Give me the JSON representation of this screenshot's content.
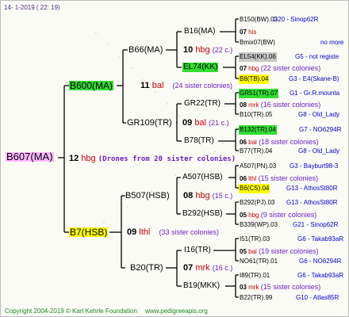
{
  "header": {
    "date": "14- 1-2019 ( 22: 19)"
  },
  "footer": {
    "copyright": "Copyright 2004-2019 © Karl Kehrle Foundation",
    "site": "www.pedigreeapis.org"
  },
  "colors": {
    "pink": "#ffb8ff",
    "yellow": "#ffff00",
    "green": "#33dd33",
    "gray": "#c8c8c8",
    "line": "#000000"
  },
  "gen0": {
    "name": "B607(MA)"
  },
  "gen1": {
    "top": {
      "name": "B600(MA)",
      "num": "11",
      "kw": "bal",
      "note": "(24 sister colonies)"
    },
    "drones": {
      "num": "12",
      "kw": "hbg",
      "note": "(Drones from 20 sister colonies)"
    },
    "bottom": {
      "name": "B7(HSB)",
      "num": "09",
      "kw": "lthl",
      "note": "(33 sister colonies)"
    }
  },
  "gen2": {
    "a": {
      "name": "B66(MA)",
      "num": "10",
      "kw": "hbg",
      "note": "(22 c.)"
    },
    "b": {
      "name": "GR109(TR)",
      "num": "09",
      "kw": "bal",
      "note": "(21 c.)"
    },
    "c": {
      "name": "B507(HSB)",
      "num": "08",
      "kw": "hbg",
      "note": "(15 c.)"
    },
    "d": {
      "name": "B20(TR)",
      "num": "07",
      "kw": "mrk",
      "note": "(16 c.)"
    }
  },
  "gen3": {
    "a": {
      "name": "B16(MA)",
      "num": "07",
      "kw": "his"
    },
    "b": {
      "name": "EL74(KK)",
      "num": "07",
      "kw": "hbg",
      "note": "(22 sister colonies)"
    },
    "c": {
      "name": "GR22(TR)",
      "num": "08",
      "kw": "mrk",
      "note": "(16 sister colonies)"
    },
    "d": {
      "name": "B78(TR)",
      "num": "06",
      "kw": "bal",
      "note": "(18 sister colonies)"
    },
    "e": {
      "name": "A507(HSB)",
      "num": "06",
      "kw": "lthl",
      "note": "(15 sister colonies)"
    },
    "f": {
      "name": "B292(HSB)",
      "num": "05",
      "kw": "hbg",
      "note": "(9 sister colonies)"
    },
    "g": {
      "name": "I16(TR)",
      "num": "05",
      "kw": "bal",
      "note": "(19 sister colonies)"
    },
    "h": {
      "name": "B19(MKK)",
      "num": "03",
      "kw": "mrk",
      "note": "(15 sister colonies)"
    }
  },
  "gen4": [
    {
      "name": "B150(BW).03",
      "id": "G20 - Sinop62R"
    },
    {
      "name": "Bmix07(BW)",
      "id": "no more"
    },
    {
      "name": "EL54(KK).06",
      "id": "G5 - not registe"
    },
    {
      "name": "B8(TB).04",
      "id": "G3 - E4(Skane-B)"
    },
    {
      "name": "GR51(TR).07",
      "id": "G1 - Gr.R.mounta"
    },
    {
      "name": "B10(TR).05",
      "id": "G8 - Old_Lady"
    },
    {
      "name": "B132(TR).04",
      "id": "G7 - NO6294R"
    },
    {
      "name": "B77(TR).04",
      "id": "G8 - Old_Lady"
    },
    {
      "name": "A507(PN).03",
      "id": "G3 - Bayburt98-3"
    },
    {
      "name": "B6(CS).04",
      "id": "G13 - AthosSt80R"
    },
    {
      "name": "B292(PJ).03",
      "id": "G13 - AthosSt80R"
    },
    {
      "name": "B339(WP).03",
      "id": "G21 - Sinop62R"
    },
    {
      "name": "I51(TR).03",
      "id": "G6 - Takab93aR"
    },
    {
      "name": "NO61(TR).01",
      "id": "G6 - NO6294R"
    },
    {
      "name": "I89(TR).01",
      "id": "G6 - Takab93aR"
    },
    {
      "name": "B22(TR).99",
      "id": "G10 - Atlas85R"
    }
  ]
}
